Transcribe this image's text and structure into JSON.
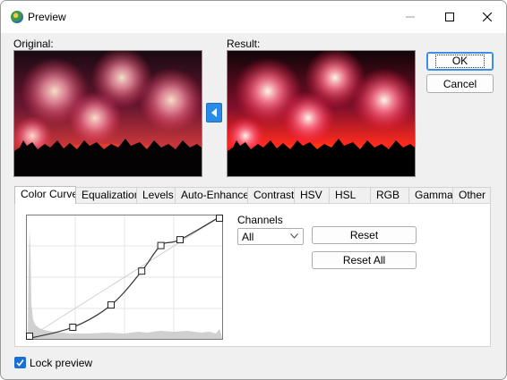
{
  "window": {
    "title": "Preview",
    "icon": "app-logo-icon"
  },
  "preview": {
    "original_label": "Original:",
    "result_label": "Result:",
    "copy_icon": "arrow-left-icon"
  },
  "buttons": {
    "ok": "OK",
    "cancel": "Cancel",
    "reset": "Reset",
    "reset_all": "Reset All"
  },
  "tabs": [
    {
      "label": "Color Curve",
      "active": true
    },
    {
      "label": "Equalization",
      "active": false
    },
    {
      "label": "Levels",
      "active": false
    },
    {
      "label": "Auto-Enhance",
      "active": false
    },
    {
      "label": "Contrast",
      "active": false
    },
    {
      "label": "HSV",
      "active": false
    },
    {
      "label": "HSL",
      "active": false
    },
    {
      "label": "RGB",
      "active": false
    },
    {
      "label": "Gamma",
      "active": false
    },
    {
      "label": "Other",
      "active": false
    }
  ],
  "channels": {
    "label": "Channels",
    "selected": "All"
  },
  "curve": {
    "range": [
      0,
      255
    ],
    "control_points": [
      [
        0,
        0
      ],
      [
        60,
        24
      ],
      [
        110,
        70
      ],
      [
        150,
        140
      ],
      [
        175,
        193
      ],
      [
        200,
        205
      ],
      [
        255,
        255
      ]
    ]
  },
  "lock_preview": {
    "label": "Lock preview",
    "checked": true
  },
  "colors": {
    "accent": "#2a8be6",
    "checkbox": "#1b6fd0"
  }
}
